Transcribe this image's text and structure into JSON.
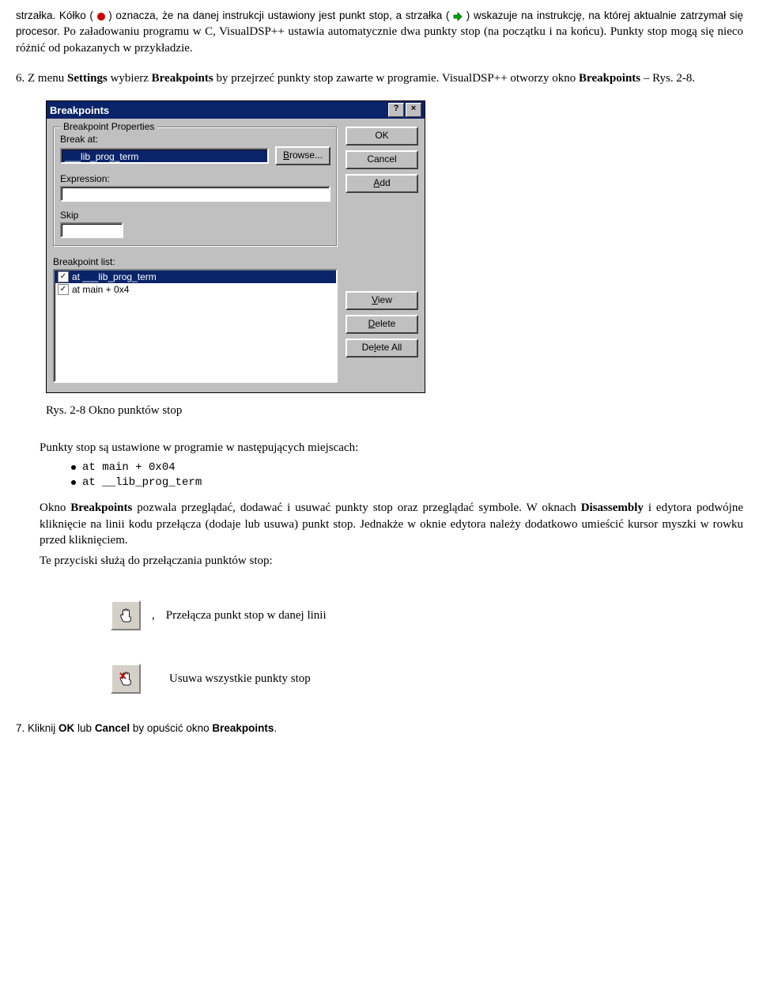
{
  "para1_a": "strzałka. Kółko ( ",
  "para1_b": " ) oznacza, że na danej instrukcji ustawiony jest punkt stop, a strzałka ( ",
  "para1_c": " ) wskazuje na instrukcję, na której aktualnie zatrzymał się procesor. Po załadowaniu programu w C, VisualDSP++ ustawia automatycznie dwa punkty stop (na początku i na końcu). Punkty stop mogą się nieco różnić od pokazanych w przykładzie.",
  "para2_prefix": "6. Z menu ",
  "para2_b1": "Settings",
  "para2_mid1": " wybierz ",
  "para2_b2": "Breakpoints",
  "para2_mid2": " by przejrzeć punkty stop zawarte w programie. VisualDSP++ otworzy okno ",
  "para2_b3": "Breakpoints",
  "para2_end": " – Rys. 2-8.",
  "dialog": {
    "title": "Breakpoints",
    "group_title": "Breakpoint Properties",
    "break_at_label": "Break at:",
    "break_at_value": "___lib_prog_term",
    "browse_label": "Browse...",
    "expression_label": "Expression:",
    "skip_label": "Skip",
    "list_label": "Breakpoint list:",
    "list_items": [
      {
        "text": "at ___lib_prog_term",
        "checked": true
      },
      {
        "text": "at main + 0x4",
        "checked": true
      }
    ],
    "buttons": {
      "ok": "OK",
      "cancel": "Cancel",
      "add": "Add",
      "view": "View",
      "delete": "Delete",
      "delete_all": "Delete All"
    }
  },
  "figure_caption": "Rys. 2-8 Okno punktów stop",
  "para3": "Punkty stop są ustawione w programie w następujących miejscach:",
  "bullets": {
    "b1": "at main + 0x04",
    "b2": "at __lib_prog_term"
  },
  "para4_a": "Okno ",
  "para4_b1": "Breakpoints",
  "para4_b": " pozwala przeglądać, dodawać i usuwać punkty stop oraz przeglądać symbole. W oknach ",
  "para4_b2": "Disassembly",
  "para4_c": " i edytora podwójne kliknięcie na linii kodu przełącza (dodaje lub usuwa) punkt stop. Jednakże w oknie edytora należy dodatkowo umieścić kursor myszki w rowku przed kliknięciem.",
  "para5": "Te przyciski służą do przełączania punktów stop:",
  "icon_labels": {
    "toggle": "Przełącza punkt stop w danej linii",
    "clear_all": "Usuwa wszystkie punkty stop"
  },
  "para6_a": "7. Kliknij ",
  "para6_b1": "OK",
  "para6_b": " lub ",
  "para6_b2": "Cancel",
  "para6_c": " by opuścić okno ",
  "para6_b3": "Breakpoints",
  "para6_d": "."
}
